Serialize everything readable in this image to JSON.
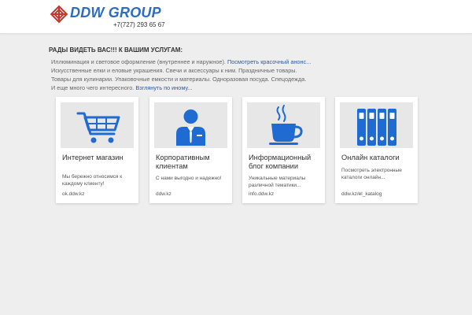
{
  "header": {
    "brand": "DDW GROUP",
    "phone": "+7(727) 293 65 67",
    "logo_icon": "knot-logo-icon",
    "accent": "#2d6cc0",
    "logo_color": "#c0392b"
  },
  "greeting": "РАДЫ ВИДЕТЬ ВАС!!! К ВАШИМ УСЛУГАМ:",
  "intro": {
    "line1": "Иллюминация и световое оформление (внутреннее и наружное).",
    "line1_link": "Посмотреть красочный анонс...",
    "line2": "Искусственные елки и еловые украшения. Свечи и аксессуары к ним. Праздничные товары.",
    "line3": "Товары для кулинарии. Упаковочные емкости и материалы. Одноразовая посуда. Спецодежда.",
    "line4": "И еще много чего интересного.",
    "line4_link": "Взглянуть по иному..."
  },
  "cards": [
    {
      "icon": "shopping-cart-icon",
      "title": "Интернет магазин",
      "desc": "Мы бережно относимся к каждому клиенту!",
      "url": "ok.ddw.kz"
    },
    {
      "icon": "business-person-icon",
      "title": "Корпоративным клиентам",
      "desc": "С нами выгодно и надежно!",
      "url": "ddw.kz"
    },
    {
      "icon": "coffee-cup-icon",
      "title": "Информационный блог компании",
      "desc": "Уникальные материалы различной тематики...",
      "url": "info.ddw.kz"
    },
    {
      "icon": "binders-icon",
      "title": "Онлайн каталоги",
      "desc": "Посмотреть электронные каталоги онлайн...",
      "url": "ddw.kz/el_katalog"
    }
  ]
}
